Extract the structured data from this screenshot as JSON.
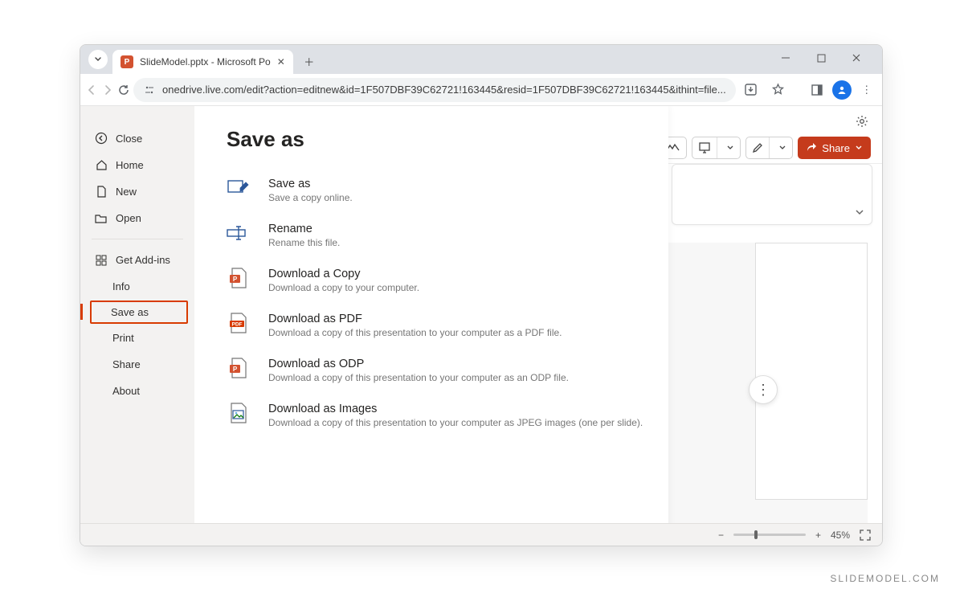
{
  "browser": {
    "tab_title": "SlideModel.pptx - Microsoft Po",
    "url": "onedrive.live.com/edit?action=editnew&id=1F507DBF39C62721!163445&resid=1F507DBF39C62721!163445&ithint=file..."
  },
  "toolbar": {
    "share_label": "Share"
  },
  "sidebar": {
    "close": "Close",
    "home": "Home",
    "new": "New",
    "open": "Open",
    "addins": "Get Add-ins",
    "info": "Info",
    "saveas": "Save as",
    "print": "Print",
    "share": "Share",
    "about": "About"
  },
  "page": {
    "title": "Save as",
    "options": [
      {
        "title": "Save as",
        "desc": "Save a copy online."
      },
      {
        "title": "Rename",
        "desc": "Rename this file."
      },
      {
        "title": "Download a Copy",
        "desc": "Download a copy to your computer."
      },
      {
        "title": "Download as PDF",
        "desc": "Download a copy of this presentation to your computer as a PDF file."
      },
      {
        "title": "Download as ODP",
        "desc": "Download a copy of this presentation to your computer as an ODP file."
      },
      {
        "title": "Download as Images",
        "desc": "Download a copy of this presentation to your computer as JPEG images (one per slide)."
      }
    ]
  },
  "status": {
    "zoom": "45%"
  },
  "watermark": "SLIDEMODEL.COM"
}
